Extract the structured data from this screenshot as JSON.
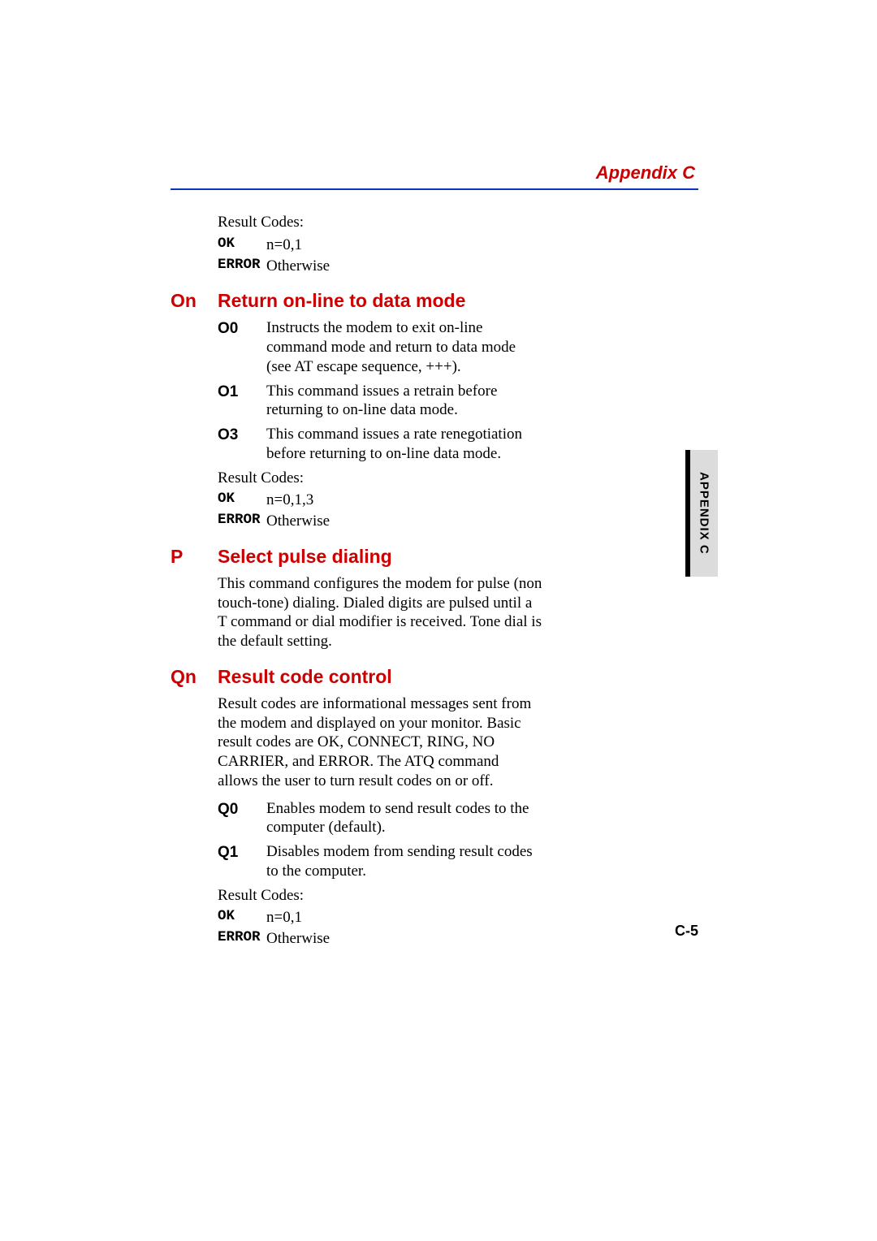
{
  "header": {
    "title": "Appendix C"
  },
  "side_tab": {
    "label": "APPENDIX C"
  },
  "page_number": "C-5",
  "pre_section": {
    "result_label": "Result Codes:",
    "rows": [
      {
        "key": "OK",
        "val": "n=0,1"
      },
      {
        "key": "ERROR",
        "val": "Otherwise"
      }
    ]
  },
  "sec_on": {
    "key": "On",
    "title": "Return on-line to data mode",
    "defs": [
      {
        "key": "O0",
        "text": "Instructs the modem to exit on-line command mode and return to data mode (see AT escape sequence, +++)."
      },
      {
        "key": "O1",
        "text": "This command issues a retrain before returning to on-line data mode."
      },
      {
        "key": "O3",
        "text": "This command issues a rate renegotiation before returning to on-line data mode."
      }
    ],
    "result_label": "Result Codes:",
    "rows": [
      {
        "key": "OK",
        "val": "n=0,1,3"
      },
      {
        "key": "ERROR",
        "val": "Otherwise"
      }
    ]
  },
  "sec_p": {
    "key": "P",
    "title": "Select pulse dialing",
    "para": "This command configures the modem for pulse (non touch-tone) dialing. Dialed digits are pulsed until a T command or dial modifier is received. Tone dial is the default setting."
  },
  "sec_qn": {
    "key": "Qn",
    "title": "Result code control",
    "para": "Result codes are informational messages sent from the modem and displayed on your monitor. Basic result codes are OK, CONNECT, RING, NO CARRIER, and ERROR. The ATQ command allows the user to turn result codes on or off.",
    "defs": [
      {
        "key": "Q0",
        "text": "Enables modem to send result codes to the computer (default)."
      },
      {
        "key": "Q1",
        "text": "Disables modem from sending result codes to the computer."
      }
    ],
    "result_label": "Result Codes:",
    "rows": [
      {
        "key": "OK",
        "val": "n=0,1"
      },
      {
        "key": "ERROR",
        "val": "Otherwise"
      }
    ]
  }
}
